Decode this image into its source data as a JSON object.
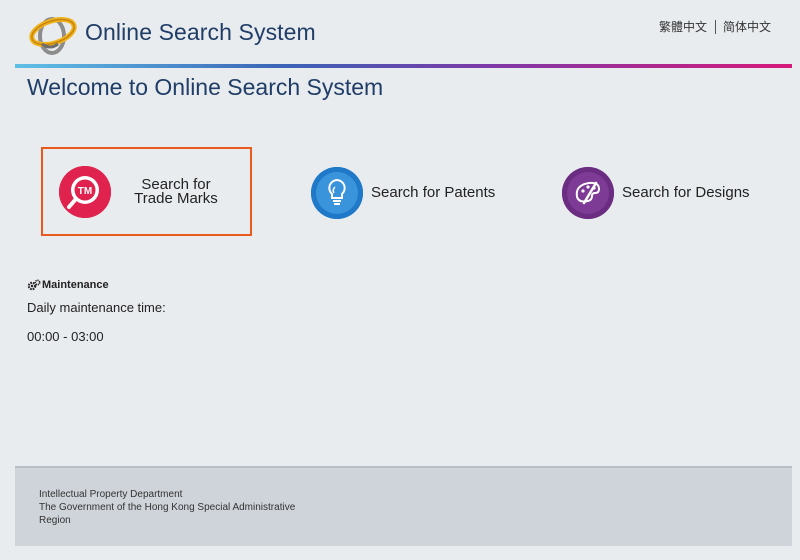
{
  "header": {
    "app_title": "Online Search System",
    "lang_traditional": "繁體中文",
    "lang_simplified": "简体中文"
  },
  "page": {
    "title": "Welcome to Online Search System"
  },
  "search_options": [
    {
      "label": "Search for Trade Marks",
      "icon": "trademark-icon",
      "color": "#e0234e",
      "selected": true
    },
    {
      "label": "Search for Patents",
      "icon": "lightbulb-icon",
      "color": "#1f78c8"
    },
    {
      "label": "Search for Designs",
      "icon": "palette-icon",
      "color": "#6b2d82"
    }
  ],
  "maintenance": {
    "heading": "Maintenance",
    "text": "Daily maintenance time:",
    "time": "00:00 - 03:00"
  },
  "footer": {
    "line1": "Intellectual Property Department",
    "line2": "The Government of the Hong Kong Special Administrative",
    "line3": "Region"
  },
  "colors": {
    "title": "#1f3d67",
    "highlight_border": "#ea5a1c",
    "gradient": [
      "#5fc0e6",
      "#3b63b6",
      "#7b3aa8",
      "#d6197a"
    ]
  }
}
